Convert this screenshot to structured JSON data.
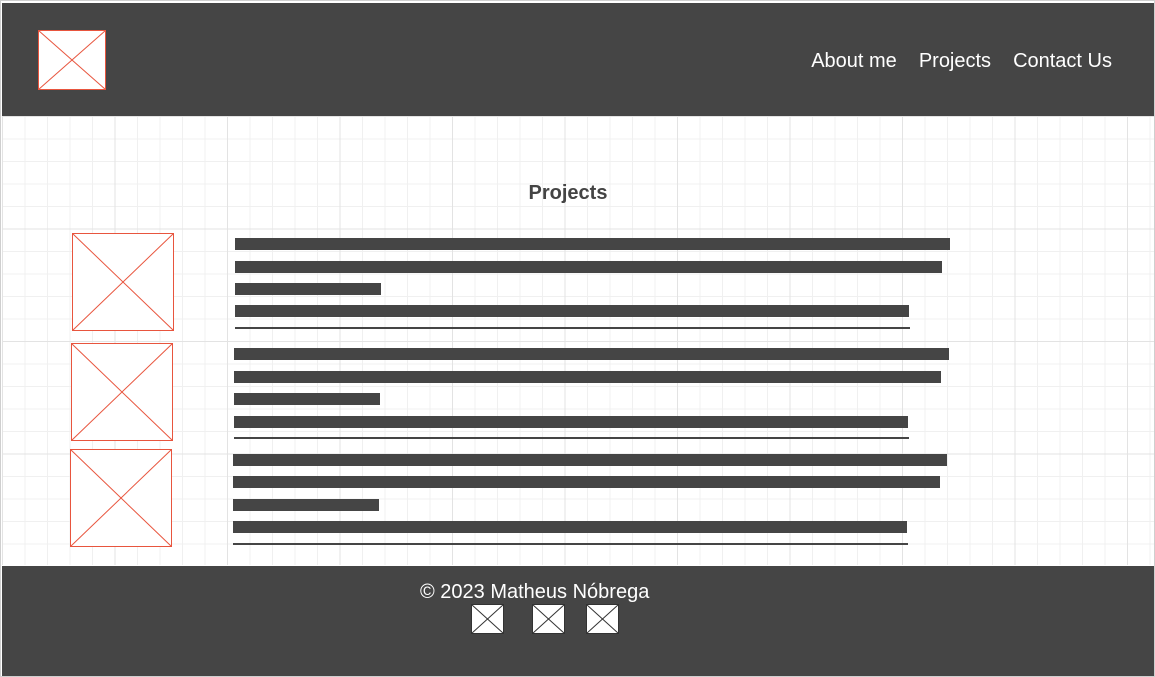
{
  "header": {
    "logo_icon": "image-placeholder-icon",
    "nav": [
      {
        "label": "About me"
      },
      {
        "label": "Projects"
      },
      {
        "label": "Contact Us"
      }
    ]
  },
  "main": {
    "title": "Projects",
    "projects": [
      {
        "thumbnail_icon": "image-placeholder-icon"
      },
      {
        "thumbnail_icon": "image-placeholder-icon"
      },
      {
        "thumbnail_icon": "image-placeholder-icon"
      }
    ]
  },
  "footer": {
    "copyright": "© 2023 Matheus Nóbrega",
    "social_icons": [
      "image-placeholder-icon",
      "image-placeholder-icon",
      "image-placeholder-icon"
    ]
  },
  "colors": {
    "dark": "#454545",
    "placeholder_accent": "#e8553e",
    "grid": "#e3e3e3"
  }
}
